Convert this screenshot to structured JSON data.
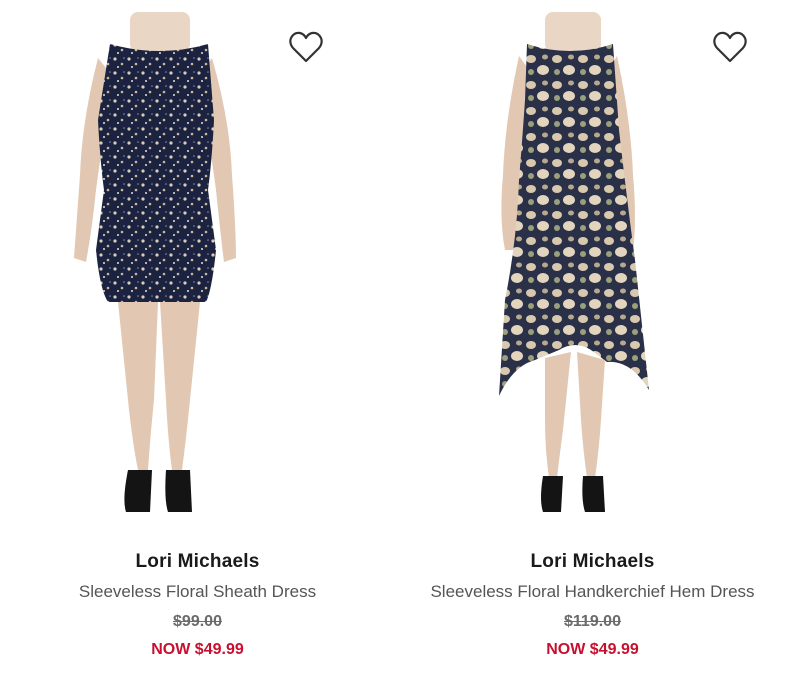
{
  "products": [
    {
      "brand": "Lori Michaels",
      "name": "Sleeveless Floral Sheath Dress",
      "original_price": "$99.00",
      "sale_price": "NOW $49.99"
    },
    {
      "brand": "Lori Michaels",
      "name": "Sleeveless Floral Handkerchief Hem Dress",
      "original_price": "$119.00",
      "sale_price": "NOW $49.99"
    }
  ],
  "colors": {
    "sale": "#c8102e",
    "brand": "#1a1a1a",
    "name": "#555555",
    "original_price": "#6b6b6b"
  },
  "icons": {
    "favorite": "heart-outline-icon"
  }
}
